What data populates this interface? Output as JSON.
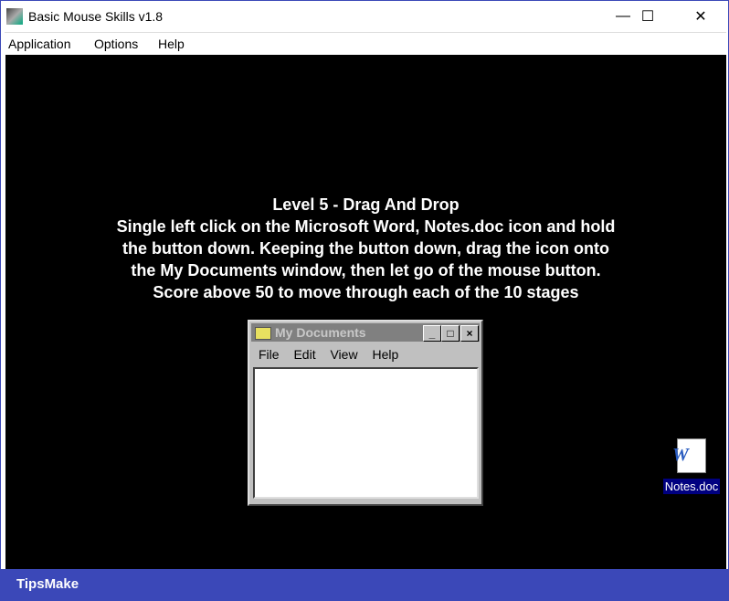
{
  "window": {
    "title": "Basic Mouse Skills v1.8",
    "controls": {
      "minimize": "—",
      "maximize": "☐",
      "close": "✕"
    }
  },
  "menu": [
    "Application",
    "Options",
    "Help"
  ],
  "instructions": {
    "heading": "Level 5 - Drag And Drop",
    "lines": [
      "Single left click on the Microsoft Word, Notes.doc icon and hold",
      "the button down. Keeping the button down, drag the icon onto",
      "the My Documents window, then let go of the mouse button.",
      "Score above 50 to move through each of the 10 stages"
    ]
  },
  "my_documents": {
    "title": "My Documents",
    "menu": [
      "File",
      "Edit",
      "View",
      "Help"
    ],
    "buttons": {
      "min": "_",
      "max": "□",
      "close": "×"
    }
  },
  "desktop_icon": {
    "label": "Notes.doc",
    "glyph": "W"
  },
  "banner": {
    "text": "TipsMake"
  }
}
